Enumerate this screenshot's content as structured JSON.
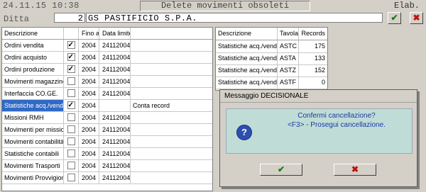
{
  "header": {
    "clock": "24.11.15 10:38",
    "title": "Delete movimenti obsoleti",
    "elab": "Elab."
  },
  "ditta": {
    "label": "Ditta",
    "code": "2",
    "name": "GS PASTIFICIO S.P.A."
  },
  "toolbar": {
    "ok_icon": "check-icon",
    "cancel_icon": "x-icon",
    "ok_color": "#1a7a1a",
    "cancel_color": "#c01010"
  },
  "left_table": {
    "headers": {
      "desc": "Descrizione",
      "fino": "Fino al",
      "data": "Data limite"
    },
    "rows": [
      {
        "desc": "Ordini vendita",
        "checked": true,
        "fino": "2004",
        "data": "24112004",
        "extra": ""
      },
      {
        "desc": "Ordini acquisto",
        "checked": true,
        "fino": "2004",
        "data": "24112004",
        "extra": ""
      },
      {
        "desc": "Ordini produzione",
        "checked": true,
        "fino": "2004",
        "data": "24112004",
        "extra": ""
      },
      {
        "desc": "Movimenti magazzino",
        "checked": false,
        "fino": "2004",
        "data": "24112004",
        "extra": ""
      },
      {
        "desc": "Interfaccia CO.GE.",
        "checked": false,
        "fino": "2004",
        "data": "24112004",
        "extra": ""
      },
      {
        "desc": "Statistiche acq./vend.",
        "checked": true,
        "fino": "2004",
        "data": "",
        "extra": "Conta record",
        "selected": true
      },
      {
        "desc": "Missioni RMH",
        "checked": false,
        "fino": "2004",
        "data": "24112004",
        "extra": ""
      },
      {
        "desc": "Movimenti per missioni",
        "checked": false,
        "fino": "2004",
        "data": "24112004",
        "extra": ""
      },
      {
        "desc": "Movimenti contabilità",
        "checked": false,
        "fino": "2004",
        "data": "24112004",
        "extra": ""
      },
      {
        "desc": "Statistiche contabili",
        "checked": false,
        "fino": "2004",
        "data": "24112004",
        "extra": ""
      },
      {
        "desc": "Movimenti Trasporti",
        "checked": false,
        "fino": "2004",
        "data": "24112004",
        "extra": ""
      },
      {
        "desc": "Movimenti Provvigioni",
        "checked": false,
        "fino": "2004",
        "data": "24112004",
        "extra": ""
      }
    ]
  },
  "right_table": {
    "headers": {
      "desc": "Descrizione",
      "tavola": "Tavola",
      "records": "Records"
    },
    "rows": [
      {
        "desc": "Statistiche acq./vend.",
        "tavola": "ASTC",
        "records": "175"
      },
      {
        "desc": "Statistiche acq./vend.",
        "tavola": "ASTA",
        "records": "133"
      },
      {
        "desc": "Statistiche acq./vend.",
        "tavola": "ASTZ",
        "records": "152"
      },
      {
        "desc": "Statistiche acq./vend.",
        "tavola": "ASTF",
        "records": "0"
      }
    ]
  },
  "dialog": {
    "title": "Messaggio DECISIONALE",
    "icon": "question-icon",
    "line1": "Confermi cancellazione?",
    "line2": "<F3> - Prosegui cancellazione.",
    "ok_icon": "check-icon",
    "cancel_icon": "x-icon"
  }
}
